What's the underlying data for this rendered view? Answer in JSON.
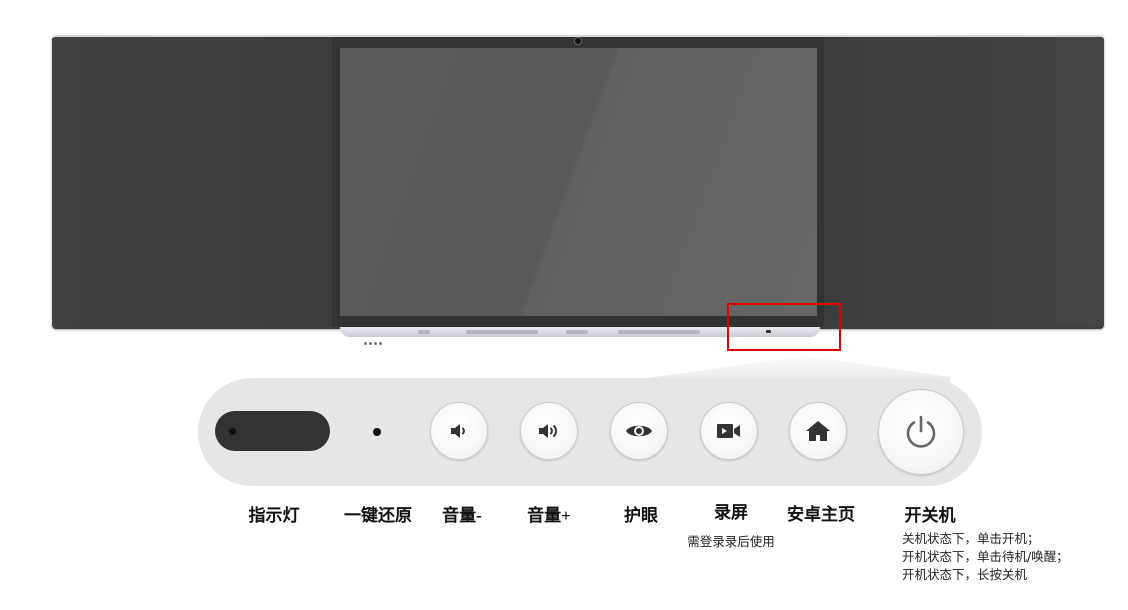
{
  "buttons": {
    "indicator": {
      "label": "指示灯",
      "icon": "indicator-light"
    },
    "reset": {
      "label": "一键还原",
      "icon": "reset-dot"
    },
    "volume_down": {
      "label": "音量-",
      "icon": "volume-down-icon"
    },
    "volume_up": {
      "label": "音量+",
      "icon": "volume-up-icon"
    },
    "eye_care": {
      "label": "护眼",
      "icon": "eye-icon"
    },
    "record": {
      "label": "录屏",
      "note": "需登录录后使用",
      "icon": "video-camera-icon"
    },
    "home": {
      "label": "安卓主页",
      "icon": "home-icon"
    },
    "power": {
      "label": "开关机",
      "icon": "power-icon",
      "notes": [
        "关机状态下，单击开机；",
        "开机状态下，单击待机/唤醒；",
        "开机状态下，长按关机"
      ]
    }
  },
  "colors": {
    "highlight": "#e00000",
    "board": "#404040",
    "strip": "#e6e6e6",
    "icon": "#333333"
  }
}
